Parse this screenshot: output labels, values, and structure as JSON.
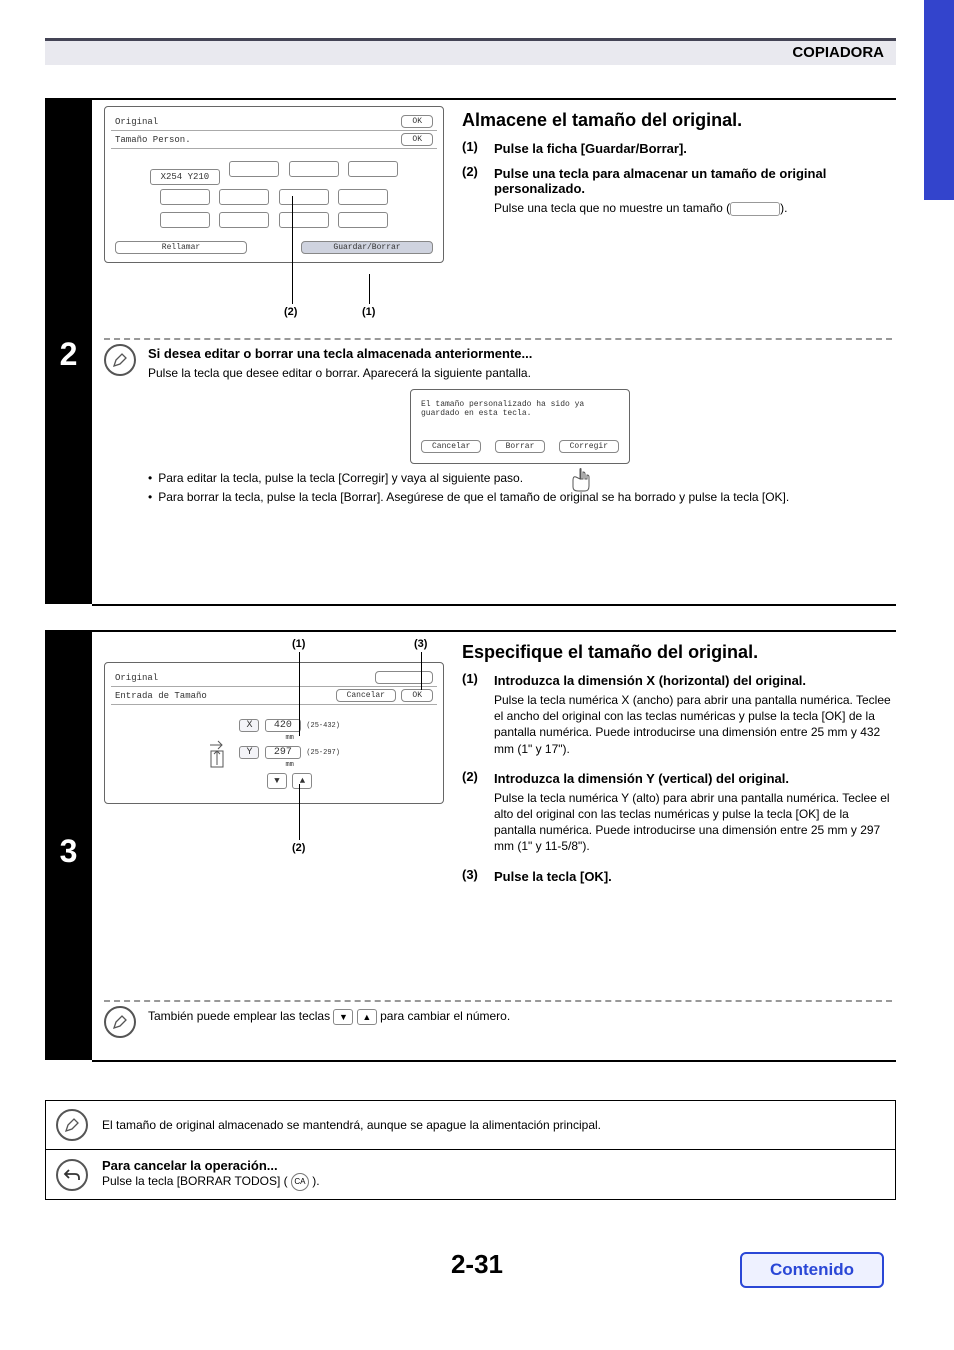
{
  "header": {
    "title": "COPIADORA"
  },
  "page_number": "2-31",
  "contenido": "Contenido",
  "step2": {
    "number": "2",
    "heading": "Almacene el tamaño del original.",
    "items": [
      {
        "n": "(1)",
        "bold": "Pulse la ficha [Guardar/Borrar]."
      },
      {
        "n": "(2)",
        "bold": "Pulse una tecla para almacenar un tamaño de original personalizado.",
        "body_pre": "Pulse una tecla que no muestre un tamaño (",
        "body_post": ")."
      }
    ],
    "screen1": {
      "title": "Original",
      "ok": "OK",
      "subtitle": "Tamaño Person.",
      "ok2": "OK",
      "stored_key": "X254 Y210",
      "tab_left": "Rellamar",
      "tab_right": "Guardar/Borrar",
      "callout_left": "(2)",
      "callout_right": "(1)"
    },
    "note_intro_bold": "Si desea editar o borrar una tecla almacenada anteriormente...",
    "note_intro_body": "Pulse la tecla que desee editar o borrar. Aparecerá la siguiente pantalla.",
    "popup": {
      "line1": "El tamaño personalizado ha sido ya",
      "line2": "guardado en esta tecla.",
      "btn_cancel": "Cancelar",
      "btn_delete": "Borrar",
      "btn_amend": "Corregir"
    },
    "bullets": [
      "Para editar la tecla, pulse la tecla [Corregir] y vaya al siguiente paso.",
      "Para borrar la tecla, pulse la tecla [Borrar]. Asegúrese de que el tamaño de original se ha borrado y pulse la tecla [OK]."
    ]
  },
  "step3": {
    "number": "3",
    "heading": "Especifique el tamaño del original.",
    "callouts": {
      "c1": "(1)",
      "c2": "(2)",
      "c3": "(3)"
    },
    "screen": {
      "title": "Original",
      "subtitle": "Entrada de Tamaño",
      "btn_cancel": "Cancelar",
      "btn_ok": "OK",
      "x_label": "X",
      "x_val": "420",
      "x_range": "(25-432)",
      "y_label": "Y",
      "y_val": "297",
      "y_range": "(25-297)",
      "unit": "mm"
    },
    "items": [
      {
        "n": "(1)",
        "bold": "Introduzca la dimensión X (horizontal) del original.",
        "body": "Pulse la tecla numérica X (ancho) para abrir una pantalla numérica. Teclee el ancho del original con las teclas numéricas y pulse la tecla [OK] de la pantalla numérica. Puede introducirse una dimensión entre 25 mm y 432 mm (1\" y 17\")."
      },
      {
        "n": "(2)",
        "bold": "Introduzca la dimensión Y (vertical) del original.",
        "body": "Pulse la tecla numérica Y (alto) para abrir una pantalla numérica. Teclee el alto del original con las teclas numéricas y pulse la tecla [OK] de la pantalla numérica. Puede introducirse una dimensión entre 25 mm y 297 mm (1\" y 11-5/8\")."
      },
      {
        "n": "(3)",
        "bold": "Pulse la tecla [OK]."
      }
    ],
    "arrow_note_pre": "También puede emplear las teclas ",
    "arrow_note_post": " para cambiar el número."
  },
  "footer": {
    "note1": "El tamaño de original almacenado se mantendrá, aunque se apague la alimentación principal.",
    "cancel_bold": "Para cancelar la operación...",
    "cancel_body_pre": "Pulse la tecla [BORRAR TODOS] ( ",
    "cancel_body_post": " ).",
    "ca_label": "CA"
  }
}
